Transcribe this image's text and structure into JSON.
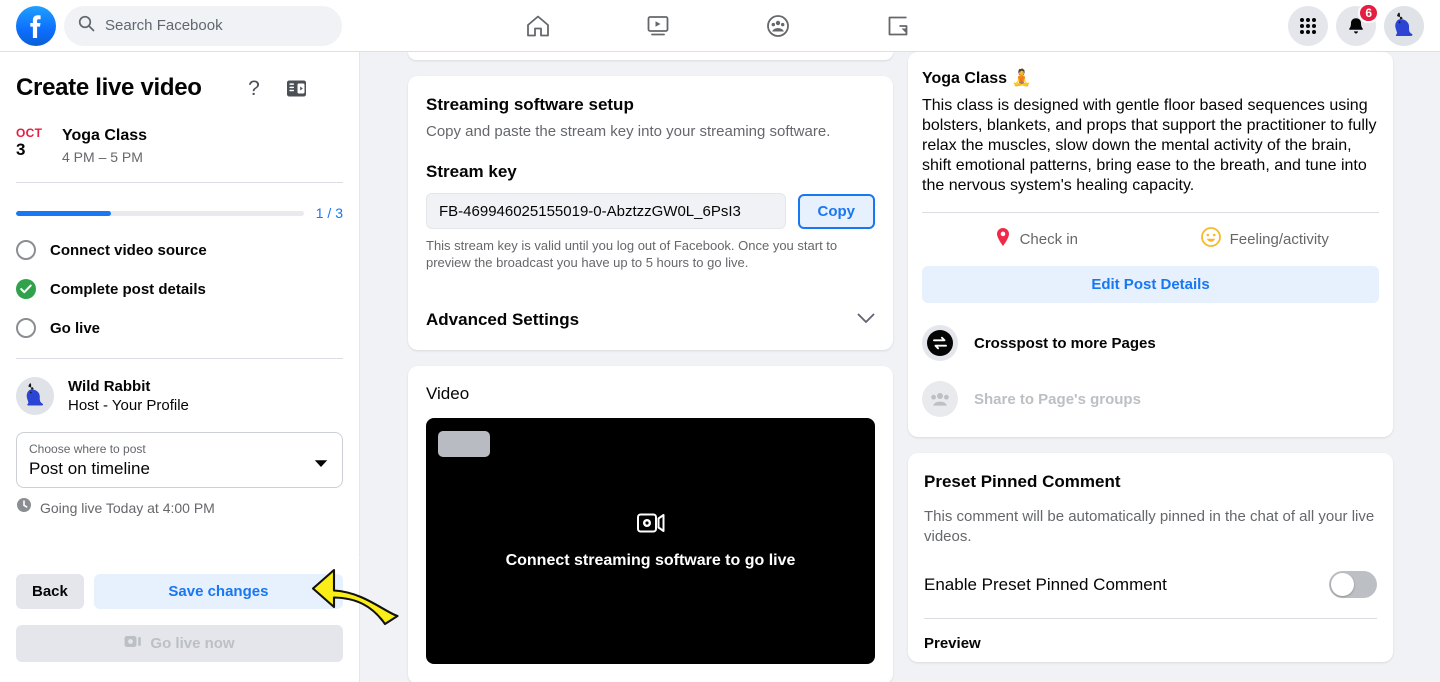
{
  "topnav": {
    "logo_icon": "facebook-logo-icon",
    "search": {
      "placeholder": "Search Facebook",
      "icon": "search-icon"
    },
    "nav_items": [
      {
        "name": "home",
        "icon": "home-icon"
      },
      {
        "name": "watch",
        "icon": "video-watch-icon"
      },
      {
        "name": "groups",
        "icon": "groups-icon"
      },
      {
        "name": "gaming",
        "icon": "gaming-icon"
      }
    ],
    "menu_icon": "grid-menu-icon",
    "notifications_icon": "bell-icon",
    "notifications_count": "6",
    "avatar_icon": "rabbit-avatar",
    "accent": "#1877f2",
    "badge_color": "#e41e3f"
  },
  "sidebar": {
    "title": "Create live video",
    "help_icon": "question-mark-icon",
    "panel_toggle_icon": "collapse-panel-icon",
    "event": {
      "month": "OCT",
      "day": "3",
      "name": "Yoga Class",
      "time": "4 PM – 5 PM"
    },
    "progress": {
      "label": "1 / 3",
      "percent": 33
    },
    "steps": [
      {
        "label": "Connect video source",
        "done": false
      },
      {
        "label": "Complete post details",
        "done": true
      },
      {
        "label": "Go live",
        "done": false
      }
    ],
    "host": {
      "name": "Wild Rabbit",
      "role": "Host - Your Profile",
      "avatar_icon": "rabbit-avatar"
    },
    "destination": {
      "label": "Choose where to post",
      "value": "Post on timeline",
      "caret_icon": "chevron-down-icon"
    },
    "schedule": {
      "icon": "clock-icon",
      "text": "Going live Today at 4:00 PM"
    },
    "footer": {
      "back_label": "Back",
      "save_label": "Save changes",
      "golive_label": "Go live now",
      "golive_icon": "live-camera-icon"
    }
  },
  "center": {
    "streaming": {
      "title": "Streaming software setup",
      "subtitle": "Copy and paste the stream key into your streaming software.",
      "stream_key_title": "Stream key",
      "stream_key_value": "FB-469946025155019-0-AbztzzGW0L_6PsI3",
      "copy_label": "Copy",
      "note": "This stream key is valid until you log out of Facebook. Once you start to preview the broadcast you have up to 5 hours to go live.",
      "advanced_label": "Advanced Settings",
      "advanced_caret_icon": "chevron-down-icon"
    },
    "video": {
      "title": "Video",
      "message": "Connect streaming software to go live",
      "icon": "camera-preview-icon"
    }
  },
  "right": {
    "post": {
      "title": "Yoga Class 🧘",
      "body": "This class is designed with gentle floor based sequences using bolsters, blankets, and props that support the practitioner to fully relax the muscles, slow down the mental activity of the brain, shift emotional patterns, bring ease to the breath, and tune into the nervous system's healing capacity.",
      "actions": [
        {
          "label": "Check in",
          "icon": "location-pin-icon",
          "color": "#f02849"
        },
        {
          "label": "Feeling/activity",
          "icon": "smiley-face-icon",
          "color": "#f7b928"
        }
      ],
      "edit_label": "Edit Post Details"
    },
    "options": [
      {
        "label": "Crosspost to more Pages",
        "icon": "crosspost-icon",
        "disabled": false
      },
      {
        "label": "Share to Page's groups",
        "icon": "groups-people-icon",
        "disabled": true
      }
    ],
    "pinned_comment": {
      "title": "Preset Pinned Comment",
      "subtitle": "This comment will be automatically pinned in the chat of all your live videos.",
      "toggle_label": "Enable Preset Pinned Comment",
      "toggle_on": false,
      "preview_label": "Preview"
    }
  },
  "annotation": {
    "arrow_icon": "yellow-curved-arrow-pointing-left",
    "color": "#faed18",
    "points_to": "Save changes"
  }
}
